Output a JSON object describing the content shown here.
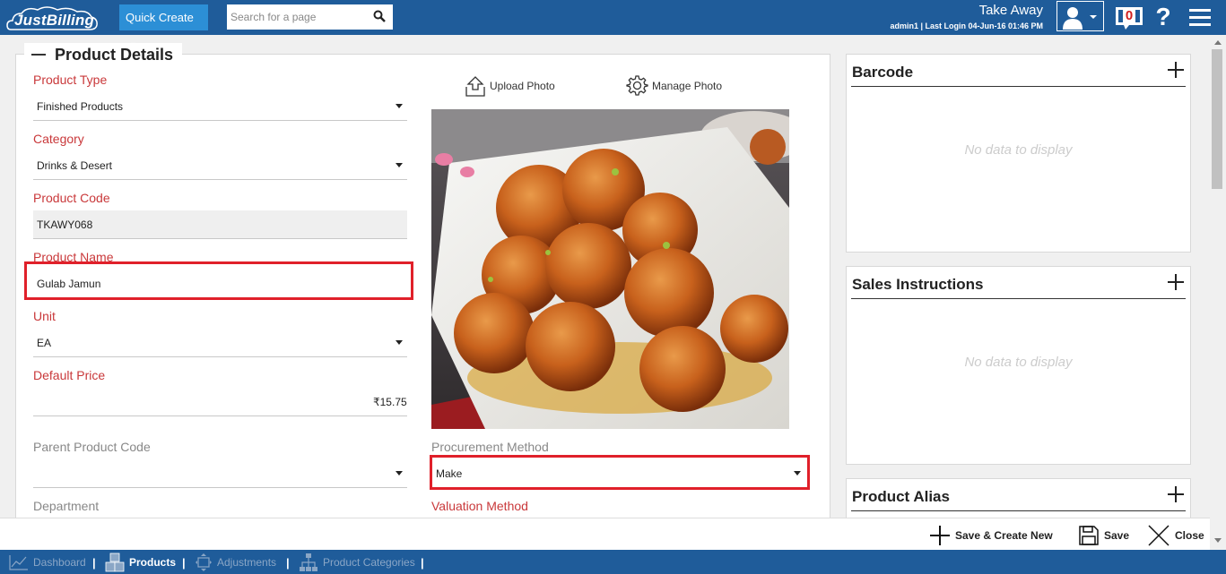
{
  "app": {
    "logo_text": "JustBilling"
  },
  "topbar": {
    "quick_create_label": "Quick Create",
    "search_placeholder": "Search for a page",
    "store_name": "Take Away",
    "login_info": "admin1 | Last Login 04-Jun-16 01:46 PM",
    "notification_count": "0",
    "help_label": "?"
  },
  "product_details": {
    "section_title": "Product Details",
    "fields": {
      "product_type": {
        "label": "Product Type",
        "value": "Finished Products"
      },
      "category": {
        "label": "Category",
        "value": "Drinks & Desert"
      },
      "product_code": {
        "label": "Product Code",
        "value": "TKAWY068"
      },
      "product_name": {
        "label": "Product Name",
        "value": "Gulab Jamun"
      },
      "unit": {
        "label": "Unit",
        "value": "EA"
      },
      "default_price": {
        "label": "Default Price",
        "value": "₹15.75"
      },
      "parent_product_code": {
        "label": "Parent Product Code",
        "value": ""
      },
      "department": {
        "label": "Department"
      },
      "procurement_method": {
        "label": "Procurement Method",
        "value": "Make"
      },
      "valuation_method": {
        "label": "Valuation Method"
      }
    },
    "upload_photo_label": "Upload Photo",
    "manage_photo_label": "Manage Photo"
  },
  "side_cards": {
    "barcode": {
      "title": "Barcode",
      "empty_text": "No data to display"
    },
    "sales_instructions": {
      "title": "Sales Instructions",
      "empty_text": "No data to display"
    },
    "product_alias": {
      "title": "Product Alias"
    }
  },
  "actions": {
    "save_create_new": "Save & Create New",
    "save": "Save",
    "close": "Close"
  },
  "bottom_nav": {
    "items": [
      {
        "label": "Dashboard",
        "icon": "dashboard-chart-icon",
        "active": false
      },
      {
        "label": "Products",
        "icon": "boxes-icon",
        "active": true
      },
      {
        "label": "Adjustments",
        "icon": "adjustments-icon",
        "active": false
      },
      {
        "label": "Product Categories",
        "icon": "hierarchy-icon",
        "active": false
      }
    ]
  },
  "colors": {
    "brand_blue": "#1f5c9a",
    "quick_create_blue": "#2c8fd6",
    "label_red": "#c9383a",
    "highlight_red": "#e0202a"
  }
}
